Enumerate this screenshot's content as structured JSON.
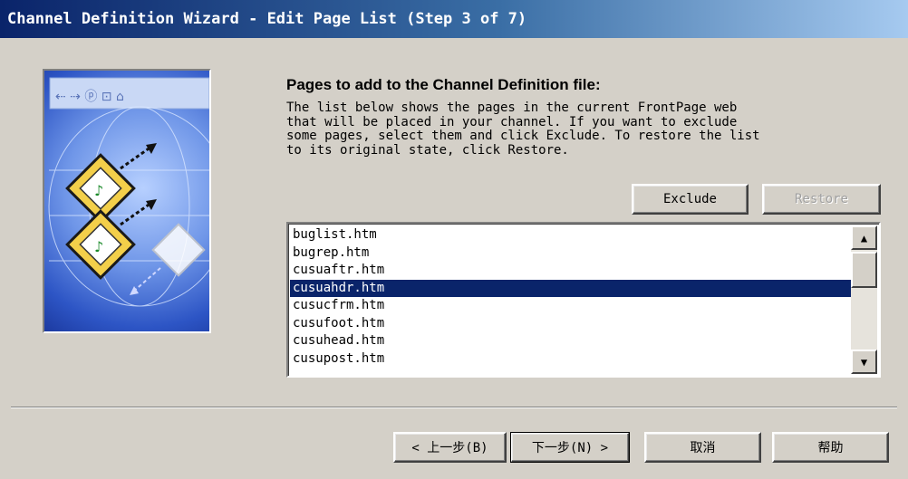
{
  "window": {
    "title": "Channel Definition Wizard - Edit Page List (Step 3 of 7)"
  },
  "main": {
    "heading": "Pages to add to the Channel Definition file:",
    "description": "The list below shows the pages in the current FrontPage web\nthat will be placed in your channel.  If you want to exclude\nsome pages, select them and click Exclude.  To restore the list\nto its original state, click Restore.",
    "exclude_label": "Exclude",
    "restore_label": "Restore",
    "pages": [
      "buglist.htm",
      "bugrep.htm",
      "cusuaftr.htm",
      "cusuahdr.htm",
      "cusucfrm.htm",
      "cusufoot.htm",
      "cusuhead.htm",
      "cusupost.htm"
    ],
    "selected_page": "cusuahdr.htm"
  },
  "footer": {
    "back_label": "< 上一步(B)",
    "next_label": "下一步(N) >",
    "cancel_label": "取消",
    "help_label": "帮助"
  },
  "colors": {
    "titlebar_start": "#0a246a",
    "selection": "#0a246a",
    "face": "#d4d0c8"
  }
}
